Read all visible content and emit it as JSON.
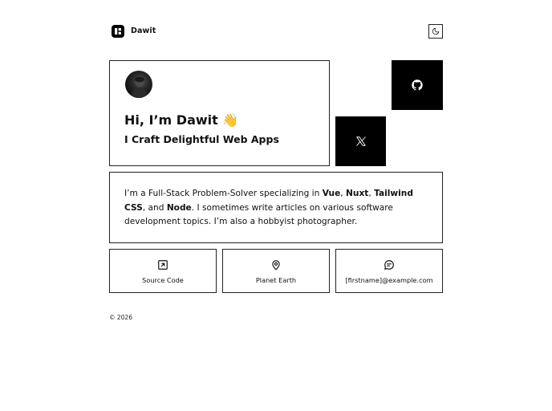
{
  "header": {
    "site_name": "Dawit",
    "logo_icon": "layout-grid-icon",
    "theme_toggle_icon": "moon-icon"
  },
  "hero": {
    "title": "Hi, I’m Dawit 👋",
    "subtitle": "I Craft Delightful Web Apps",
    "avatar_icon": "profile-photo"
  },
  "social": {
    "github_icon": "github-icon",
    "x_icon": "x-twitter-icon"
  },
  "about": {
    "intro": "I’m a Full-Stack Problem-Solver specializing in ",
    "tech1": "Vue",
    "sep1": ", ",
    "tech2": "Nuxt",
    "sep2": ", ",
    "tech3": "Tailwind CSS",
    "sep3": ", and ",
    "tech4": "Node",
    "outro": ". I sometimes write articles on various software development topics. I’m also a hobbyist photographer."
  },
  "cards": [
    {
      "label": "Source Code",
      "icon": "external-link-icon"
    },
    {
      "label": "Planet Earth",
      "icon": "map-pin-icon"
    },
    {
      "label": "[firstname]@example.com",
      "icon": "chat-bubble-icon"
    }
  ],
  "footer": {
    "copyright": "© 2026"
  },
  "colors": {
    "foreground": "#111111",
    "background": "#ffffff",
    "border": "#222222",
    "tile": "#000000"
  }
}
